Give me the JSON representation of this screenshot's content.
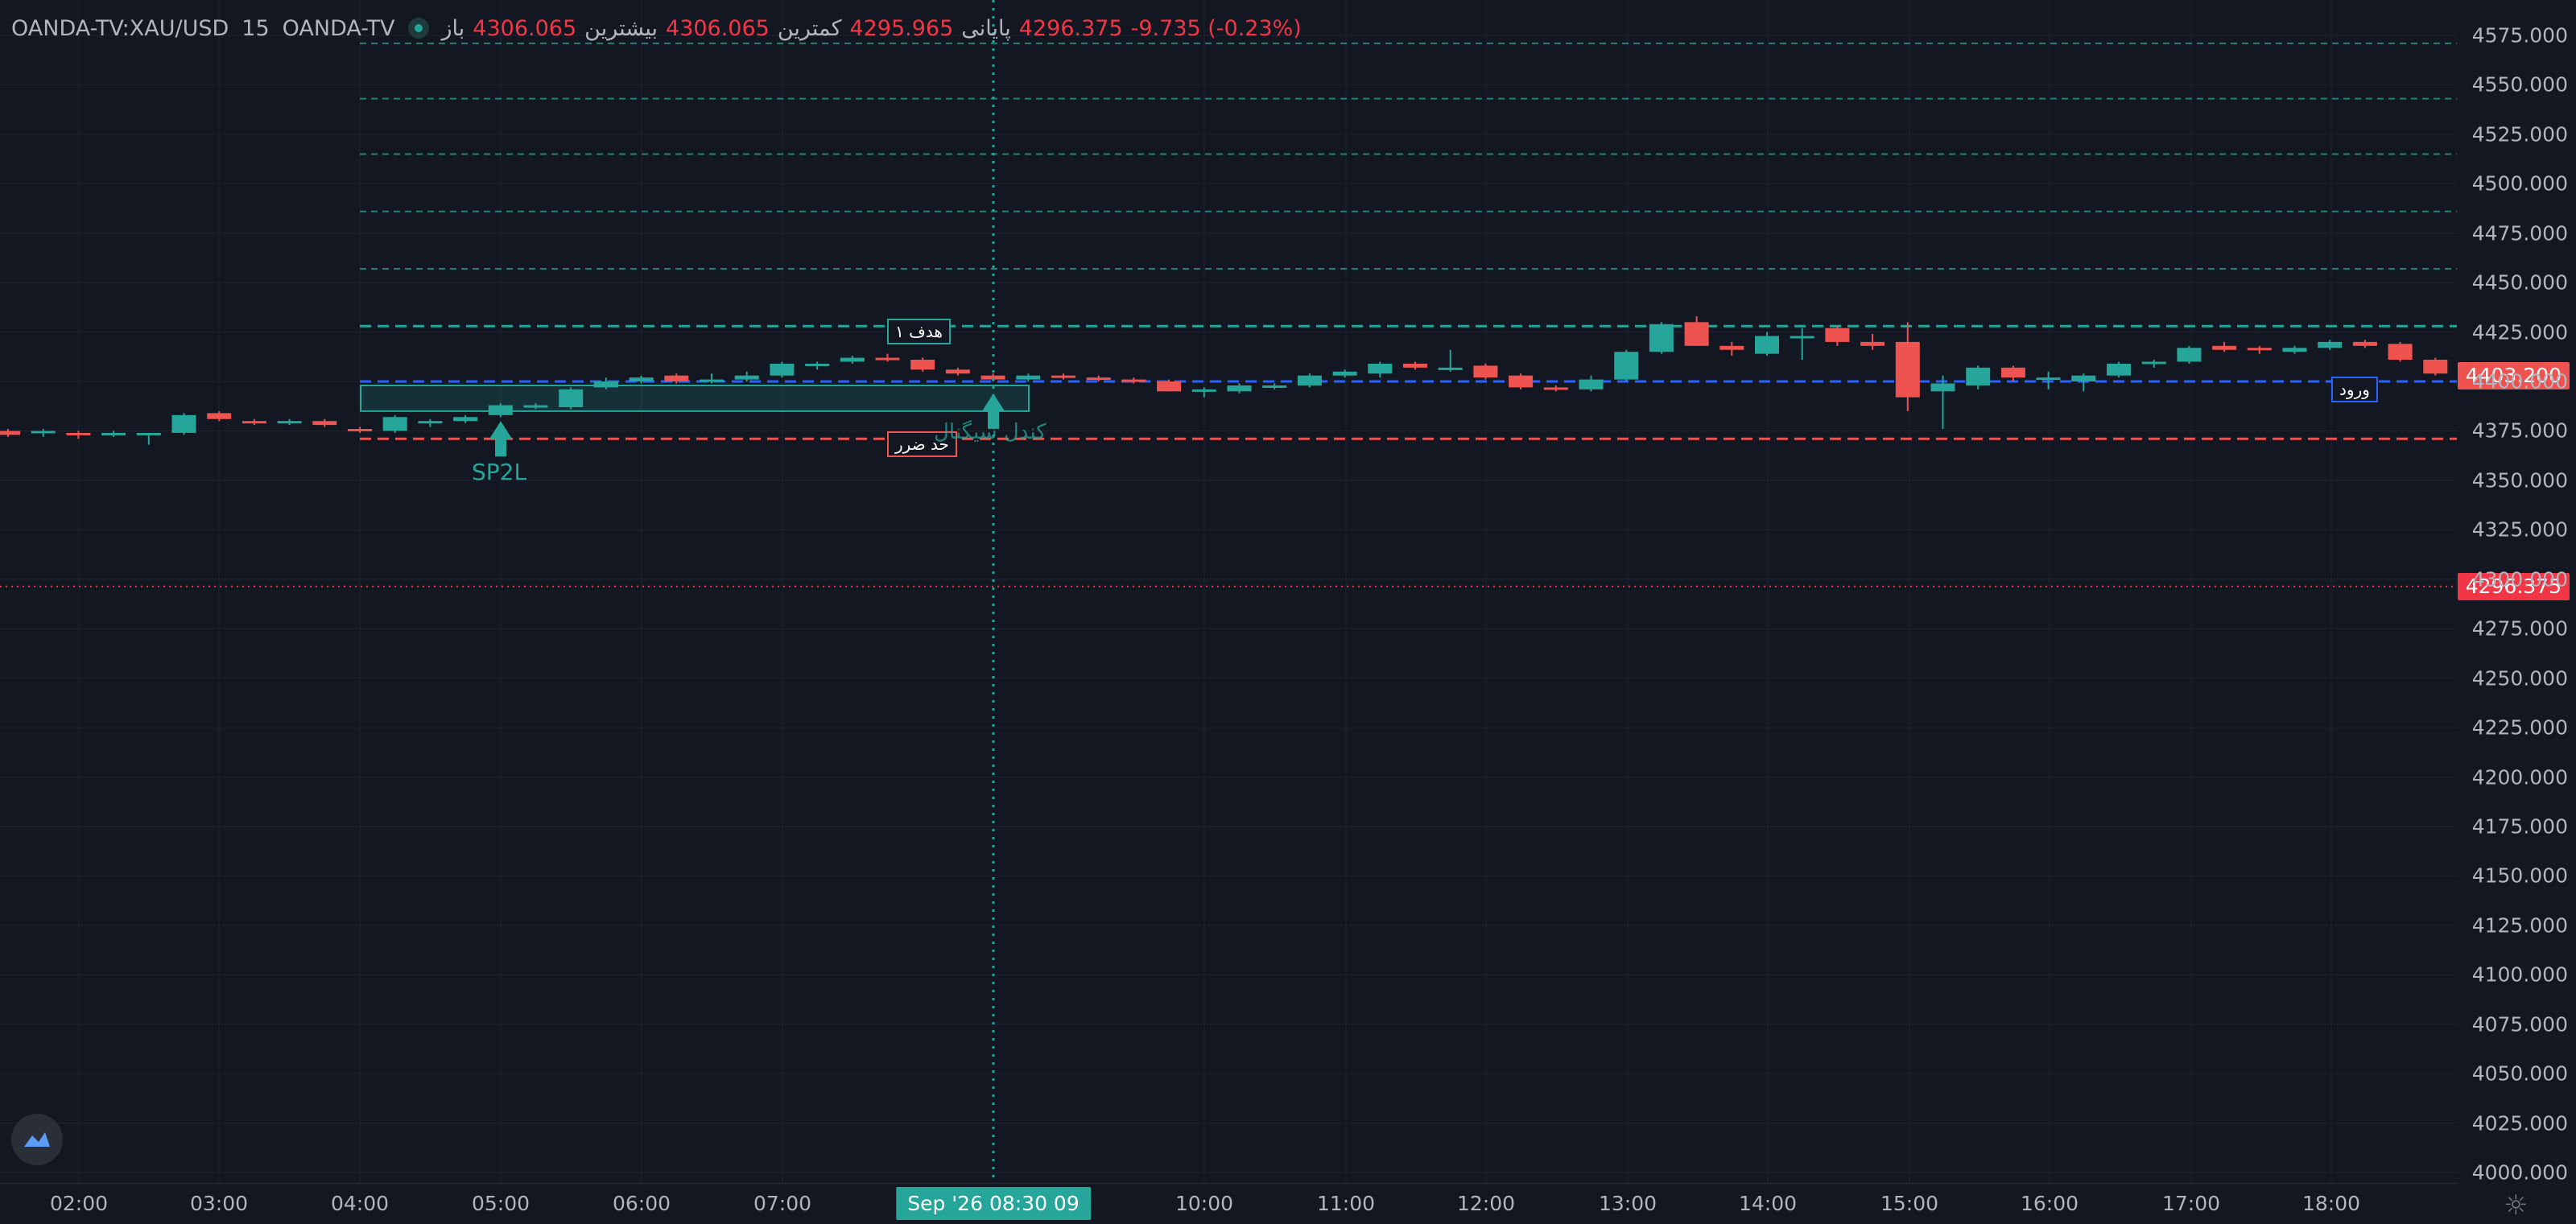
{
  "header": {
    "symbol": "OANDA-TV:XAU/USD",
    "interval": "15",
    "exchange": "OANDA-TV",
    "open_label": "باز",
    "open_value": "4306.065",
    "high_label": "بیشترین",
    "high_value": "4306.065",
    "low_label": "کمترین",
    "low_value": "4295.965",
    "close_label": "پایانی",
    "close_value": "4296.375",
    "change": "-9.735 (-0.23%)"
  },
  "price_axis": {
    "ticks": [
      "4575.000",
      "4550.000",
      "4525.000",
      "4500.000",
      "4475.000",
      "4450.000",
      "4425.000",
      "4400.000",
      "4375.000",
      "4350.000",
      "4325.000",
      "4300.000",
      "4275.000",
      "4250.000",
      "4225.000",
      "4200.000",
      "4175.000",
      "4150.000",
      "4125.000",
      "4100.000",
      "4075.000",
      "4050.000",
      "4025.000",
      "4000.000"
    ],
    "entry_tag": "4403.200",
    "last_tag": "4296.375"
  },
  "time_axis": {
    "labels": [
      "02:00",
      "03:00",
      "04:00",
      "05:00",
      "06:00",
      "07:00",
      "10:00",
      "11:00",
      "12:00",
      "13:00",
      "14:00",
      "15:00",
      "16:00",
      "17:00",
      "18:00"
    ],
    "crosshair_tag": "Sep '26   08:30 09"
  },
  "annotations": {
    "target_label": "هدف ۱",
    "stop_label": "حد ضرر",
    "entry_label": "ورود",
    "signal_label": "SP2L",
    "signal2_label": "کندل سیگنال"
  },
  "levels": {
    "target_lines": [
      4571,
      4543,
      4515,
      4486,
      4457
    ],
    "target1": 4428,
    "entry": 4400,
    "stop": 4371,
    "last_price": 4296.375
  },
  "colors": {
    "bull": "#26a69a",
    "bear": "#ef5350",
    "entry_line": "#2962ff",
    "stop_line": "#ef5350",
    "target_line": "#26a69a",
    "last_price": "#f23645",
    "grid": "#1f2330"
  },
  "chart_data": {
    "type": "candlestick",
    "x_start": "01:45",
    "x_interval_min": 15,
    "candles": [
      [
        4375,
        4376,
        4372,
        4373
      ],
      [
        4374,
        4376,
        4372,
        4375
      ],
      [
        4374,
        4375,
        4371,
        4373
      ],
      [
        4373,
        4375,
        4372,
        4374
      ],
      [
        4373,
        4374,
        4368,
        4374
      ],
      [
        4374,
        4384,
        4373,
        4383
      ],
      [
        4384,
        4385,
        4380,
        4381
      ],
      [
        4380,
        4381,
        4378,
        4379
      ],
      [
        4379,
        4381,
        4378,
        4380
      ],
      [
        4380,
        4381,
        4377,
        4378
      ],
      [
        4376,
        4377,
        4374,
        4375
      ],
      [
        4375,
        4383,
        4374,
        4382
      ],
      [
        4379,
        4381,
        4377,
        4380
      ],
      [
        4380,
        4383,
        4379,
        4382
      ],
      [
        4383,
        4389,
        4382,
        4388
      ],
      [
        4387,
        4389,
        4386,
        4388
      ],
      [
        4387,
        4397,
        4386,
        4396
      ],
      [
        4397,
        4402,
        4396,
        4400
      ],
      [
        4400,
        4403,
        4399,
        4402
      ],
      [
        4403,
        4404,
        4399,
        4400
      ],
      [
        4400,
        4404,
        4399,
        4401
      ],
      [
        4401,
        4405,
        4400,
        4403
      ],
      [
        4403,
        4410,
        4402,
        4409
      ],
      [
        4408,
        4410,
        4406,
        4409
      ],
      [
        4410,
        4413,
        4409,
        4412
      ],
      [
        4412,
        4414,
        4410,
        4411
      ],
      [
        4411,
        4412,
        4405,
        4406
      ],
      [
        4406,
        4407,
        4403,
        4404
      ],
      [
        4403,
        4404,
        4400,
        4401
      ],
      [
        4401,
        4404,
        4400,
        4403
      ],
      [
        4403,
        4404,
        4401,
        4402
      ],
      [
        4402,
        4403,
        4400,
        4401
      ],
      [
        4401,
        4402,
        4399,
        4400
      ],
      [
        4400,
        4401,
        4395,
        4395
      ],
      [
        4395,
        4397,
        4392,
        4396
      ],
      [
        4395,
        4399,
        4394,
        4398
      ],
      [
        4397,
        4399,
        4396,
        4398
      ],
      [
        4398,
        4404,
        4397,
        4403
      ],
      [
        4403,
        4406,
        4402,
        4405
      ],
      [
        4404,
        4410,
        4402,
        4409
      ],
      [
        4409,
        4410,
        4406,
        4407
      ],
      [
        4406,
        4416,
        4405,
        4407
      ],
      [
        4408,
        4409,
        4401,
        4402
      ],
      [
        4403,
        4404,
        4396,
        4397
      ],
      [
        4397,
        4398,
        4395,
        4396
      ],
      [
        4396,
        4403,
        4395,
        4401
      ],
      [
        4401,
        4416,
        4400,
        4415
      ],
      [
        4415,
        4430,
        4414,
        4429
      ],
      [
        4430,
        4433,
        4418,
        4418
      ],
      [
        4418,
        4420,
        4413,
        4416
      ],
      [
        4414,
        4425,
        4413,
        4423
      ],
      [
        4423,
        4427,
        4411,
        4423
      ],
      [
        4427,
        4428,
        4418,
        4420
      ],
      [
        4420,
        4424,
        4416,
        4418
      ],
      [
        4420,
        4430,
        4385,
        4392
      ],
      [
        4395,
        4403,
        4376,
        4399
      ],
      [
        4398,
        4408,
        4396,
        4407
      ],
      [
        4407,
        4408,
        4400,
        4402
      ],
      [
        4402,
        4405,
        4396,
        4402
      ],
      [
        4400,
        4404,
        4395,
        4403
      ],
      [
        4403,
        4410,
        4402,
        4409
      ],
      [
        4409,
        4411,
        4407,
        4410
      ],
      [
        4410,
        4418,
        4409,
        4417
      ],
      [
        4418,
        4420,
        4415,
        4416
      ],
      [
        4417,
        4418,
        4414,
        4416
      ],
      [
        4415,
        4418,
        4414,
        4417
      ],
      [
        4417,
        4421,
        4416,
        4420
      ],
      [
        4420,
        4421,
        4417,
        4418
      ],
      [
        4419,
        4420,
        4410,
        4411
      ],
      [
        4411,
        4412,
        4403,
        4404
      ]
    ],
    "ylim": [
      3993,
      4581
    ],
    "xlabel": "",
    "ylabel": ""
  }
}
